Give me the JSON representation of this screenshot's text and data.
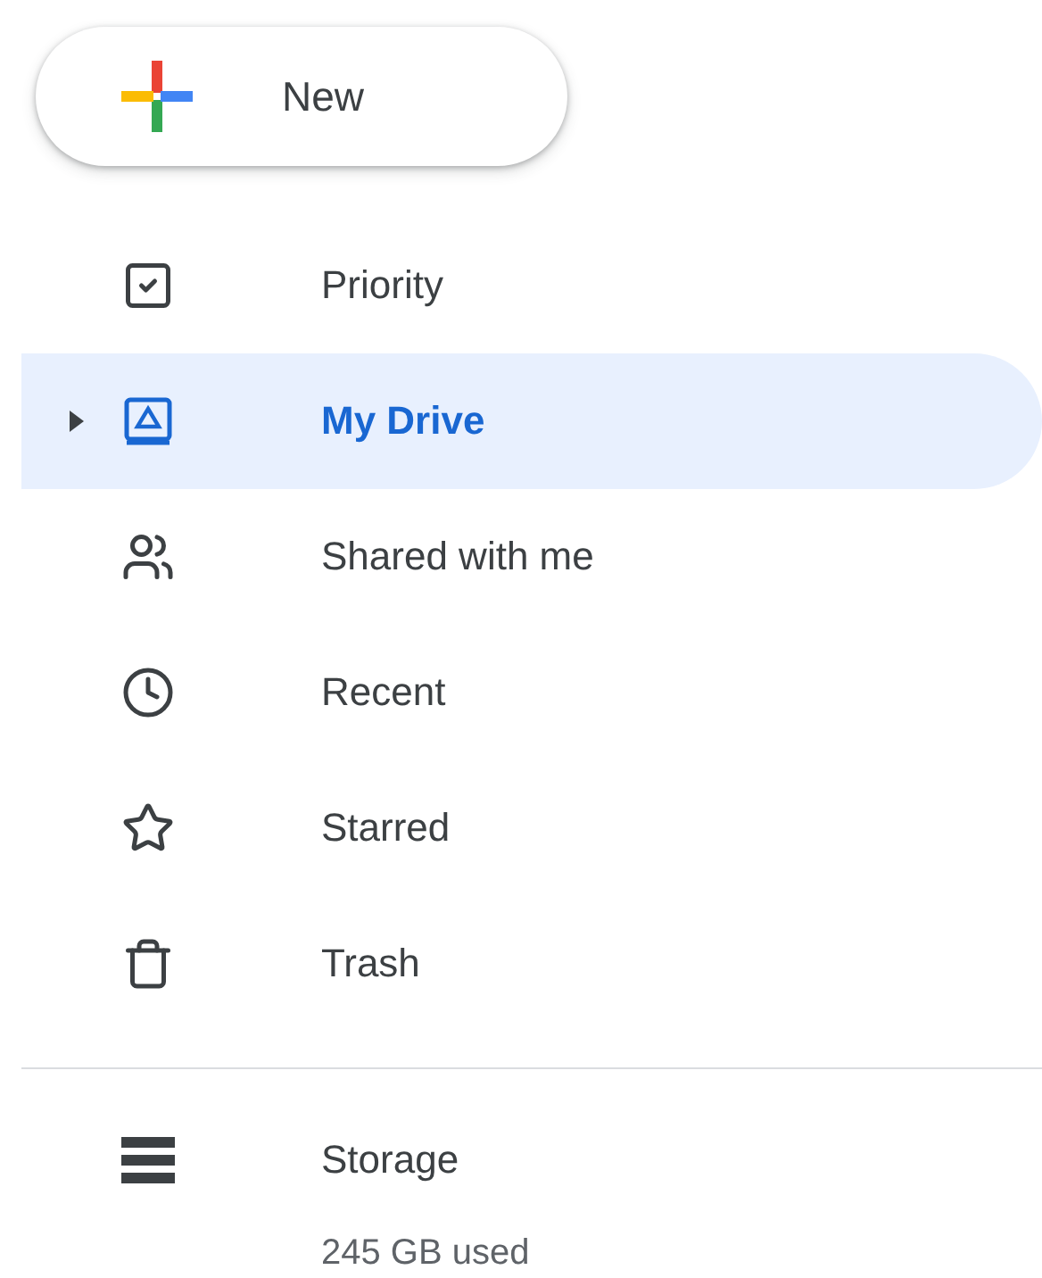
{
  "new_button": {
    "label": "New"
  },
  "nav_items": [
    {
      "kind": "priority",
      "label": "Priority",
      "selected": false,
      "has_children": false
    },
    {
      "kind": "drive",
      "label": "My Drive",
      "selected": true,
      "has_children": true
    },
    {
      "kind": "shared",
      "label": "Shared with me",
      "selected": false,
      "has_children": false
    },
    {
      "kind": "recent",
      "label": "Recent",
      "selected": false,
      "has_children": false
    },
    {
      "kind": "starred",
      "label": "Starred",
      "selected": false,
      "has_children": false
    },
    {
      "kind": "trash",
      "label": "Trash",
      "selected": false,
      "has_children": false
    }
  ],
  "storage": {
    "label": "Storage",
    "usage": "245 GB used"
  }
}
